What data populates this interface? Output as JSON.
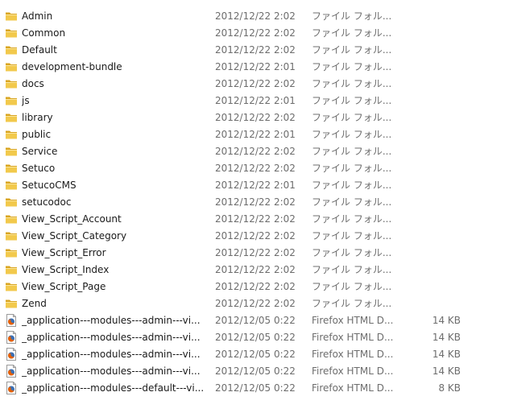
{
  "colors": {
    "folder": "#f2c94c",
    "folder_dark": "#d9a521",
    "text": "#1a1a1a",
    "meta_text": "#6d6d6d",
    "firefox_orange": "#e66000",
    "firefox_blue": "#3a6fb4"
  },
  "items": [
    {
      "name": "Admin",
      "date": "2012/12/22 2:02",
      "type": "ファイル フォル...",
      "size": "",
      "icon": "folder-icon"
    },
    {
      "name": "Common",
      "date": "2012/12/22 2:02",
      "type": "ファイル フォル...",
      "size": "",
      "icon": "folder-icon"
    },
    {
      "name": "Default",
      "date": "2012/12/22 2:02",
      "type": "ファイル フォル...",
      "size": "",
      "icon": "folder-icon"
    },
    {
      "name": "development-bundle",
      "date": "2012/12/22 2:01",
      "type": "ファイル フォル...",
      "size": "",
      "icon": "folder-icon"
    },
    {
      "name": "docs",
      "date": "2012/12/22 2:02",
      "type": "ファイル フォル...",
      "size": "",
      "icon": "folder-icon"
    },
    {
      "name": "js",
      "date": "2012/12/22 2:01",
      "type": "ファイル フォル...",
      "size": "",
      "icon": "folder-icon"
    },
    {
      "name": "library",
      "date": "2012/12/22 2:02",
      "type": "ファイル フォル...",
      "size": "",
      "icon": "folder-icon"
    },
    {
      "name": "public",
      "date": "2012/12/22 2:01",
      "type": "ファイル フォル...",
      "size": "",
      "icon": "folder-icon"
    },
    {
      "name": "Service",
      "date": "2012/12/22 2:02",
      "type": "ファイル フォル...",
      "size": "",
      "icon": "folder-icon"
    },
    {
      "name": "Setuco",
      "date": "2012/12/22 2:02",
      "type": "ファイル フォル...",
      "size": "",
      "icon": "folder-icon"
    },
    {
      "name": "SetucoCMS",
      "date": "2012/12/22 2:01",
      "type": "ファイル フォル...",
      "size": "",
      "icon": "folder-icon"
    },
    {
      "name": "setucodoc",
      "date": "2012/12/22 2:02",
      "type": "ファイル フォル...",
      "size": "",
      "icon": "folder-icon"
    },
    {
      "name": "View_Script_Account",
      "date": "2012/12/22 2:02",
      "type": "ファイル フォル...",
      "size": "",
      "icon": "folder-icon"
    },
    {
      "name": "View_Script_Category",
      "date": "2012/12/22 2:02",
      "type": "ファイル フォル...",
      "size": "",
      "icon": "folder-icon"
    },
    {
      "name": "View_Script_Error",
      "date": "2012/12/22 2:02",
      "type": "ファイル フォル...",
      "size": "",
      "icon": "folder-icon"
    },
    {
      "name": "View_Script_Index",
      "date": "2012/12/22 2:02",
      "type": "ファイル フォル...",
      "size": "",
      "icon": "folder-icon"
    },
    {
      "name": "View_Script_Page",
      "date": "2012/12/22 2:02",
      "type": "ファイル フォル...",
      "size": "",
      "icon": "folder-icon"
    },
    {
      "name": "Zend",
      "date": "2012/12/22 2:02",
      "type": "ファイル フォル...",
      "size": "",
      "icon": "folder-icon"
    },
    {
      "name": "_application---modules---admin---vi...",
      "date": "2012/12/05 0:22",
      "type": "Firefox HTML D...",
      "size": "14 KB",
      "icon": "firefox-html-file-icon"
    },
    {
      "name": "_application---modules---admin---vi...",
      "date": "2012/12/05 0:22",
      "type": "Firefox HTML D...",
      "size": "14 KB",
      "icon": "firefox-html-file-icon"
    },
    {
      "name": "_application---modules---admin---vi...",
      "date": "2012/12/05 0:22",
      "type": "Firefox HTML D...",
      "size": "14 KB",
      "icon": "firefox-html-file-icon"
    },
    {
      "name": "_application---modules---admin---vi...",
      "date": "2012/12/05 0:22",
      "type": "Firefox HTML D...",
      "size": "14 KB",
      "icon": "firefox-html-file-icon"
    },
    {
      "name": "_application---modules---default---vi...",
      "date": "2012/12/05 0:22",
      "type": "Firefox HTML D...",
      "size": "8 KB",
      "icon": "firefox-html-file-icon"
    }
  ]
}
